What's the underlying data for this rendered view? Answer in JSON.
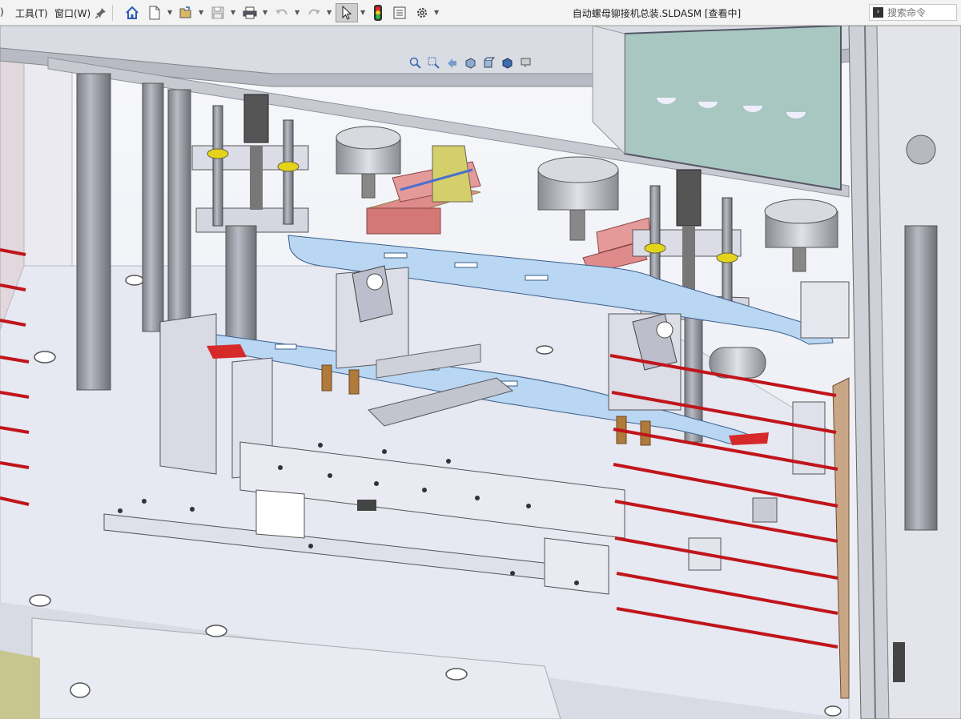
{
  "menu": {
    "partial_left": ")",
    "tools": "工具(T)",
    "window": "窗口(W)"
  },
  "document": {
    "title": "自动螺母铆接机总装.SLDASM [查看中]"
  },
  "search": {
    "placeholder": "搜索命令",
    "icon": "command-search-icon"
  },
  "toolbar": {
    "icons": [
      "pin-icon",
      "home-icon",
      "new-document-icon",
      "open-icon",
      "save-icon",
      "print-icon",
      "undo-icon",
      "redo-icon",
      "select-icon",
      "traffic-light-icon",
      "file-properties-icon",
      "options-gear-icon"
    ]
  },
  "view_toolbar": {
    "icons": [
      "zoom-to-fit-icon",
      "zoom-area-icon",
      "previous-view-icon",
      "section-view-icon",
      "view-orientation-icon",
      "display-style-icon",
      "view-settings-icon"
    ]
  },
  "colors": {
    "accent_red": "#c0151b",
    "blue_part": "#b9d6f2",
    "orange_part": "#b07a3a",
    "plate": "#e6e8f2"
  }
}
